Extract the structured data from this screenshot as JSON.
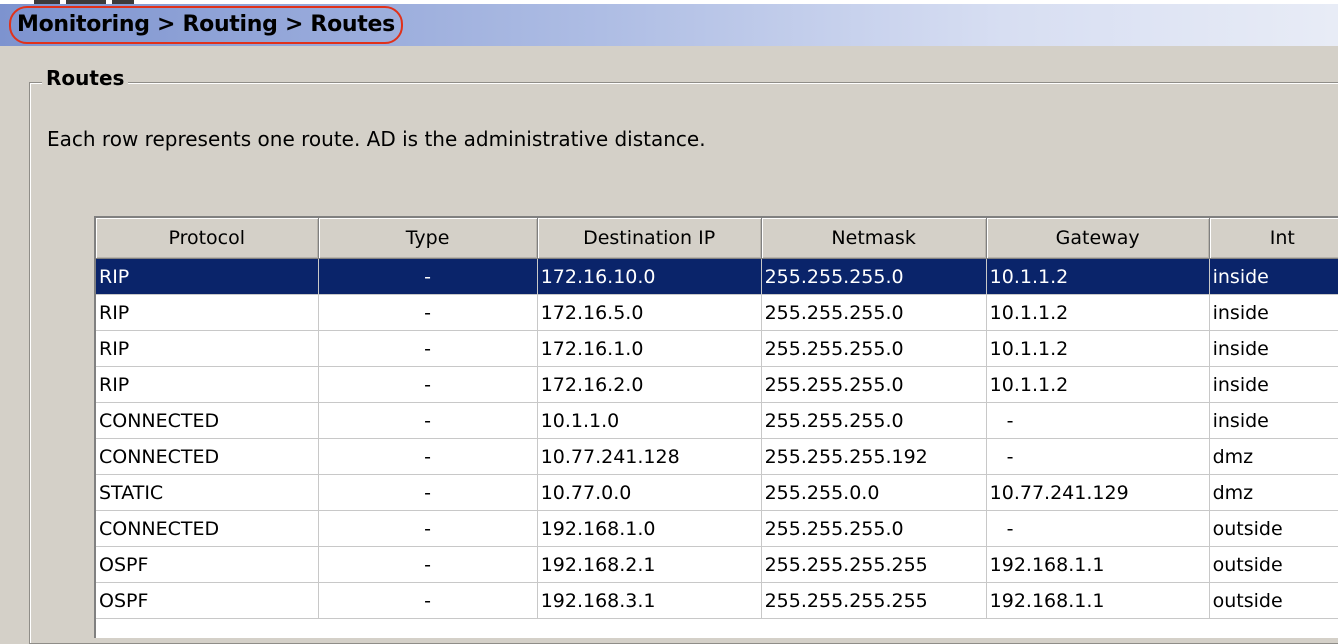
{
  "breadcrumb": "Monitoring > Routing > Routes",
  "group": {
    "title": "Routes",
    "description": "Each row represents one route. AD is the administrative distance."
  },
  "table": {
    "columns": [
      "Protocol",
      "Type",
      "Destination IP",
      "Netmask",
      "Gateway",
      "Int"
    ],
    "rows": [
      [
        "RIP",
        "-",
        "172.16.10.0",
        "255.255.255.0",
        "10.1.1.2",
        "inside"
      ],
      [
        "RIP",
        "-",
        "172.16.5.0",
        "255.255.255.0",
        "10.1.1.2",
        "inside"
      ],
      [
        "RIP",
        "-",
        "172.16.1.0",
        "255.255.255.0",
        "10.1.1.2",
        "inside"
      ],
      [
        "RIP",
        "-",
        "172.16.2.0",
        "255.255.255.0",
        "10.1.1.2",
        "inside"
      ],
      [
        "CONNECTED",
        "-",
        "10.1.1.0",
        "255.255.255.0",
        "-",
        "inside"
      ],
      [
        "CONNECTED",
        "-",
        "10.77.241.128",
        "255.255.255.192",
        "-",
        "dmz"
      ],
      [
        "STATIC",
        "-",
        "10.77.0.0",
        "255.255.0.0",
        "10.77.241.129",
        "dmz"
      ],
      [
        "CONNECTED",
        "-",
        "192.168.1.0",
        "255.255.255.0",
        "-",
        "outside"
      ],
      [
        "OSPF",
        "-",
        "192.168.2.1",
        "255.255.255.255",
        "192.168.1.1",
        "outside"
      ],
      [
        "OSPF",
        "-",
        "192.168.3.1",
        "255.255.255.255",
        "192.168.1.1",
        "outside"
      ]
    ],
    "selected_row": 0
  },
  "colors": {
    "selection": "#0a246a",
    "highlight_oval": "#e0311a",
    "panel": "#d4d0c8"
  }
}
